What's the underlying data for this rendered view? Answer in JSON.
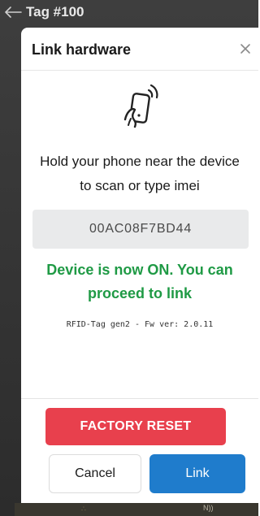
{
  "app": {
    "title": "Tag #100",
    "bottom_peek_text": "N))",
    "bottom_peek_mark": "∴"
  },
  "modal": {
    "title": "Link hardware",
    "close_icon": "close-icon",
    "illustration_icon": "phone-nfc-icon",
    "instruction_line1": "Hold your phone near the device",
    "instruction_line2": "to scan or type imei",
    "imei_value": "00AC08F7BD44",
    "status_line1": "Device is now ON. You can",
    "status_line2": "proceed to link",
    "device_info": "RFID-Tag gen2 - Fw ver: 2.0.11",
    "factory_reset_label": "FACTORY RESET",
    "cancel_label": "Cancel",
    "link_label": "Link"
  },
  "colors": {
    "status_green": "#1f9a45",
    "factory_reset_red": "#e8404d",
    "link_blue": "#1f7ccc",
    "input_bg": "#e9eaeb"
  }
}
